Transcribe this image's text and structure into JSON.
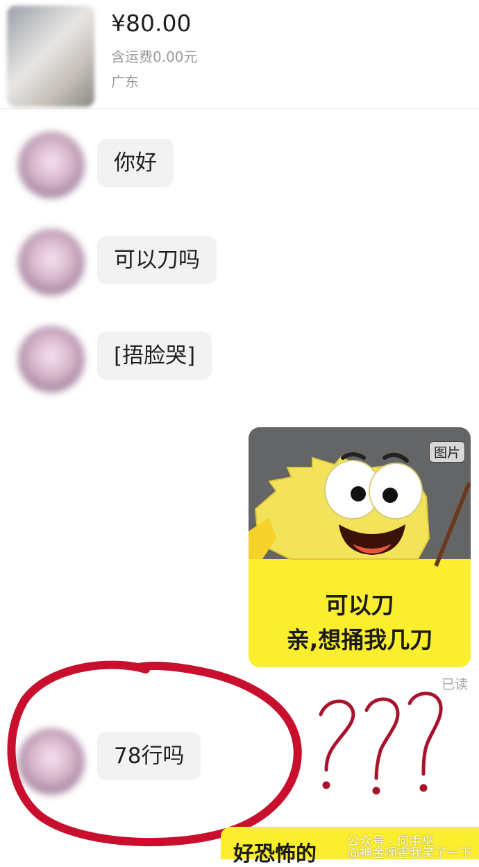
{
  "product": {
    "price": "¥80.00",
    "shipping": "含运费0.00元",
    "location": "广东"
  },
  "messages": [
    {
      "text": "你好"
    },
    {
      "text": "可以刀吗"
    },
    {
      "text": "[捂脸哭]"
    },
    {
      "text": "78行吗"
    }
  ],
  "sticker": {
    "tag": "图片",
    "line1": "可以刀",
    "line2": "亲,想捅我几刀"
  },
  "read_status": "已读",
  "annotation": {
    "marks": "???",
    "color": "#c8102e"
  },
  "bottom_banner": {
    "text": "好恐怖的"
  },
  "watermark": {
    "line1": "公众号 · 何手巫",
    "line2": "@神金啊害我笑了一下"
  }
}
